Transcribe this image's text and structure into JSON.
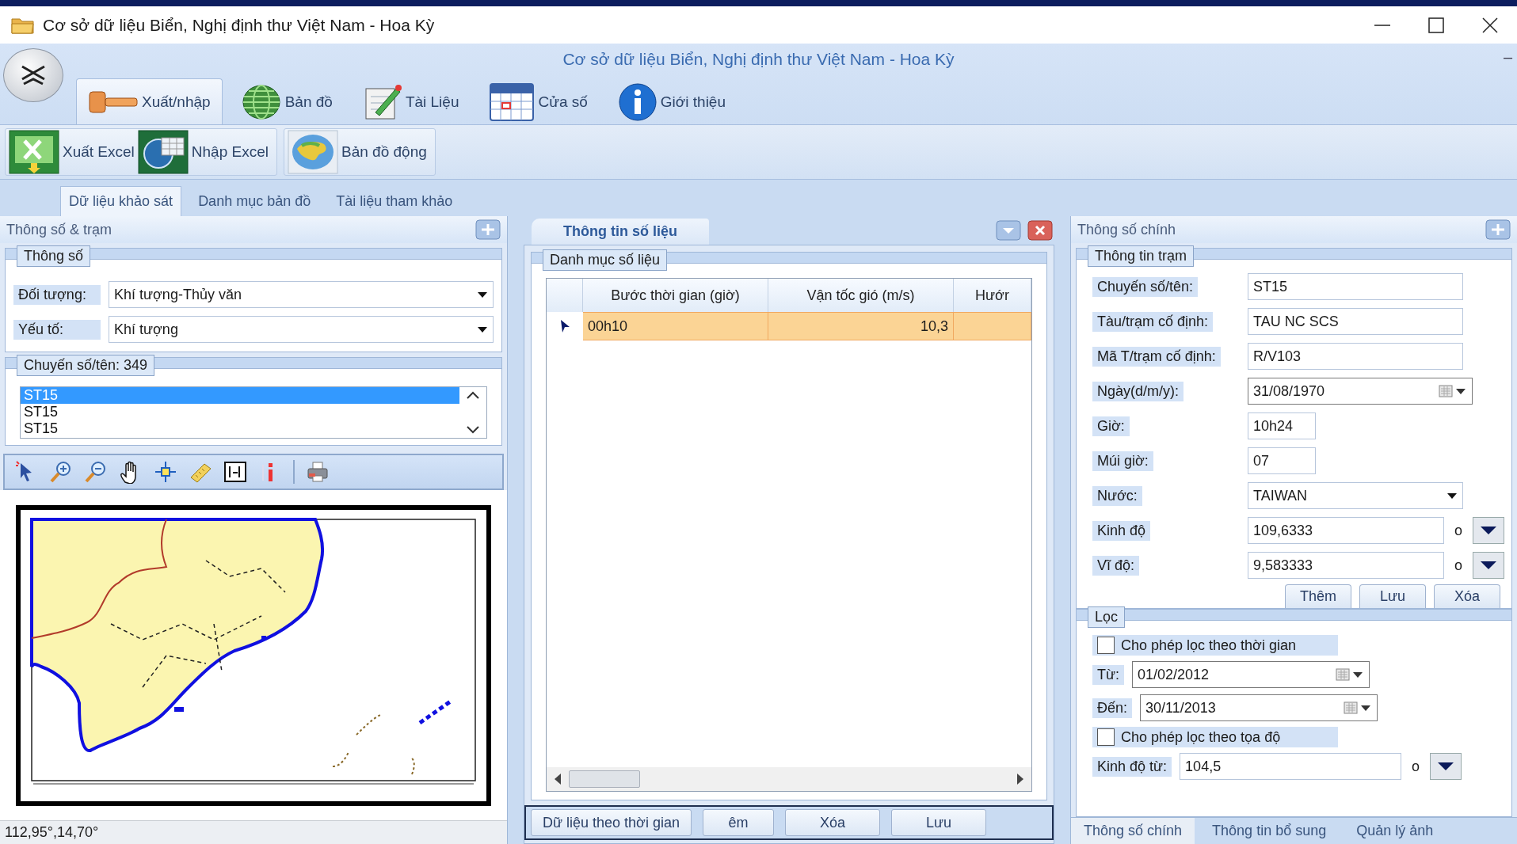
{
  "window": {
    "title": "Cơ sở dữ liệu Biển, Nghị định thư Việt Nam - Hoa Kỳ"
  },
  "ribbon": {
    "title": "Cơ sở dữ liệu Biển, Nghị định thư Việt Nam - Hoa Kỳ",
    "minimize": "–",
    "tabs": [
      {
        "label": "Xuất/nhập",
        "kind": "hammer",
        "selected": true
      },
      {
        "label": "Bản đồ",
        "kind": "globe",
        "selected": false
      },
      {
        "label": "Tài Liệu",
        "kind": "document",
        "selected": false
      },
      {
        "label": "Cửa số",
        "kind": "calendar",
        "selected": false
      },
      {
        "label": "Giới thiệu",
        "kind": "info",
        "selected": false
      }
    ],
    "groups": [
      [
        {
          "label": "Xuất Excel",
          "kind": "export"
        },
        {
          "label": "Nhập Excel",
          "kind": "import"
        }
      ],
      [
        {
          "label": "Bản đồ động",
          "kind": "map"
        }
      ]
    ]
  },
  "view_tabs": [
    {
      "label": "Dữ liệu khảo sát",
      "selected": true
    },
    {
      "label": "Danh mục bản đồ",
      "selected": false
    },
    {
      "label": "Tài liệu tham khảo",
      "selected": false
    }
  ],
  "left_panel": {
    "title": "Thông số & trạm",
    "parameters": {
      "title": "Thông số",
      "fields": [
        {
          "label": "Đối tượng:",
          "value": "Khí tượng-Thủy văn"
        },
        {
          "label": "Yếu tố:",
          "value": "Khí tượng"
        }
      ]
    },
    "stations": {
      "title": "Chuyến số/tên: 349",
      "items": [
        {
          "label": "ST15",
          "selected": true
        },
        {
          "label": "ST15",
          "selected": false
        },
        {
          "label": "ST15",
          "selected": false
        }
      ]
    },
    "status": "112,95°,14,70°"
  },
  "data_panel": {
    "tab": "Thông tin số liệu",
    "group": "Danh mục số liệu",
    "columns": [
      "Bước thời gian (giờ)",
      "Vận tốc gió (m/s)",
      "Hướr"
    ],
    "rows": [
      {
        "cells": [
          "00h10",
          "10,3"
        ],
        "selected": true
      }
    ],
    "buttons": [
      "Dữ liệu theo thời gian",
      "êm",
      "Xóa",
      "Lưu"
    ]
  },
  "station_panel": {
    "title": "Thông số chính",
    "group": "Thông tin trạm",
    "fields": [
      {
        "kind": "text",
        "label": "Chuyến số/tên:",
        "value": "ST15"
      },
      {
        "kind": "text",
        "label": "Tàu/trạm cố định:",
        "value": "TAU NC SCS"
      },
      {
        "kind": "text",
        "label": "Mã T/trạm cố định:",
        "value": "R/V103"
      },
      {
        "kind": "date",
        "label": "Ngày(d/m/y):",
        "value": "31/08/1970"
      },
      {
        "kind": "short",
        "label": "Giờ:",
        "value": "10h24"
      },
      {
        "kind": "short",
        "label": "Múi giờ:",
        "value": "07"
      },
      {
        "kind": "combo",
        "label": "Nước:",
        "value": "TAIWAN"
      },
      {
        "kind": "coordinate",
        "label": "Kinh độ",
        "value": "109,6333",
        "unit": "o"
      },
      {
        "kind": "coordinate",
        "label": "Vĩ độ:",
        "value": "9,583333",
        "unit": "o"
      }
    ],
    "buttons": [
      "Thêm",
      "Lưu",
      "Xóa"
    ],
    "filter": {
      "title": "Lọc",
      "items": [
        {
          "kind": "checkbox",
          "label": "Cho phép lọc theo thời gian",
          "checked": false
        },
        {
          "kind": "date",
          "label": "Từ:",
          "value": "01/02/2012"
        },
        {
          "kind": "date",
          "label": "Đến:",
          "value": "30/11/2013"
        },
        {
          "kind": "checkbox",
          "label": "Cho phép lọc theo tọa độ",
          "checked": false
        },
        {
          "kind": "coordinate",
          "label": "Kinh độ từ:",
          "value": "104,5",
          "unit": "o"
        }
      ]
    },
    "tabs": [
      {
        "label": "Thông số chính",
        "selected": true
      },
      {
        "label": "Thông tin bổ sung",
        "selected": false
      },
      {
        "label": "Quản lý ảnh",
        "selected": false
      }
    ]
  }
}
